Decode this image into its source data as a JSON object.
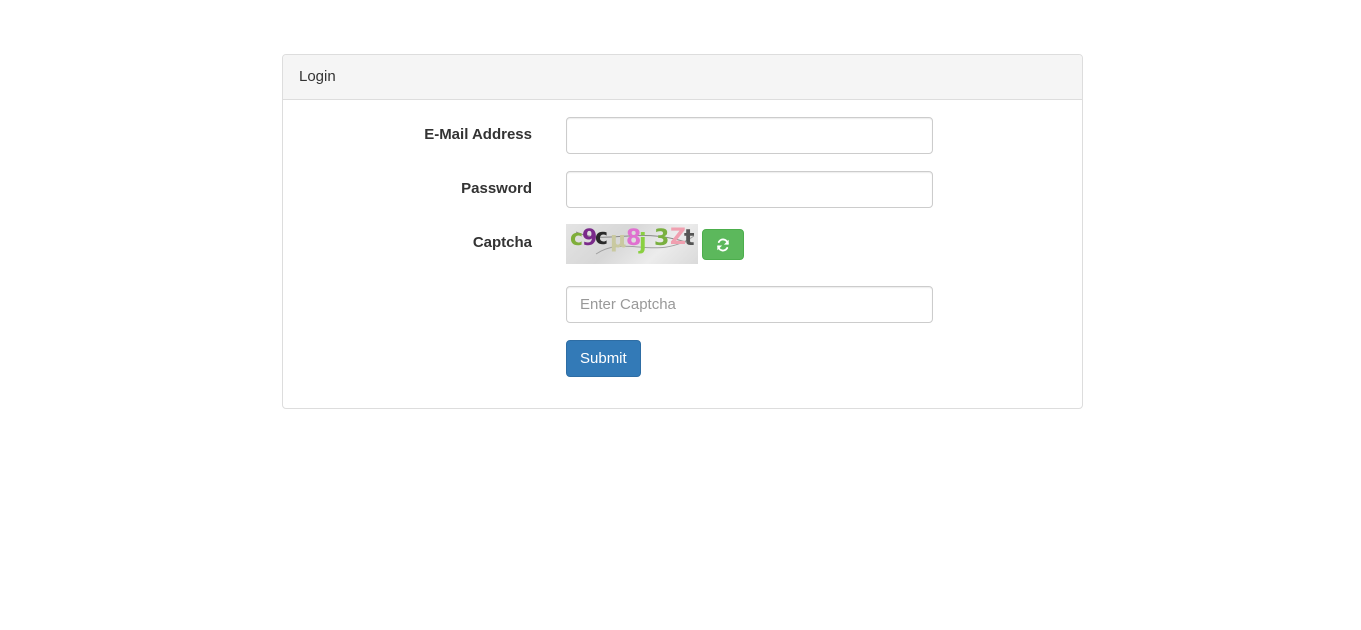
{
  "panel": {
    "heading": "Login"
  },
  "form": {
    "email": {
      "label": "E-Mail Address",
      "value": "",
      "placeholder": ""
    },
    "password": {
      "label": "Password",
      "value": "",
      "placeholder": ""
    },
    "captcha": {
      "label": "Captcha",
      "image_text": "c9cμ8j3Zt",
      "refresh_icon": "refresh-icon",
      "input_value": "",
      "input_placeholder": "Enter Captcha"
    },
    "submit_label": "Submit"
  },
  "colors": {
    "primary": "#337ab7",
    "success": "#5cb85c",
    "panel_heading_bg": "#f5f5f5",
    "border": "#dddddd"
  }
}
